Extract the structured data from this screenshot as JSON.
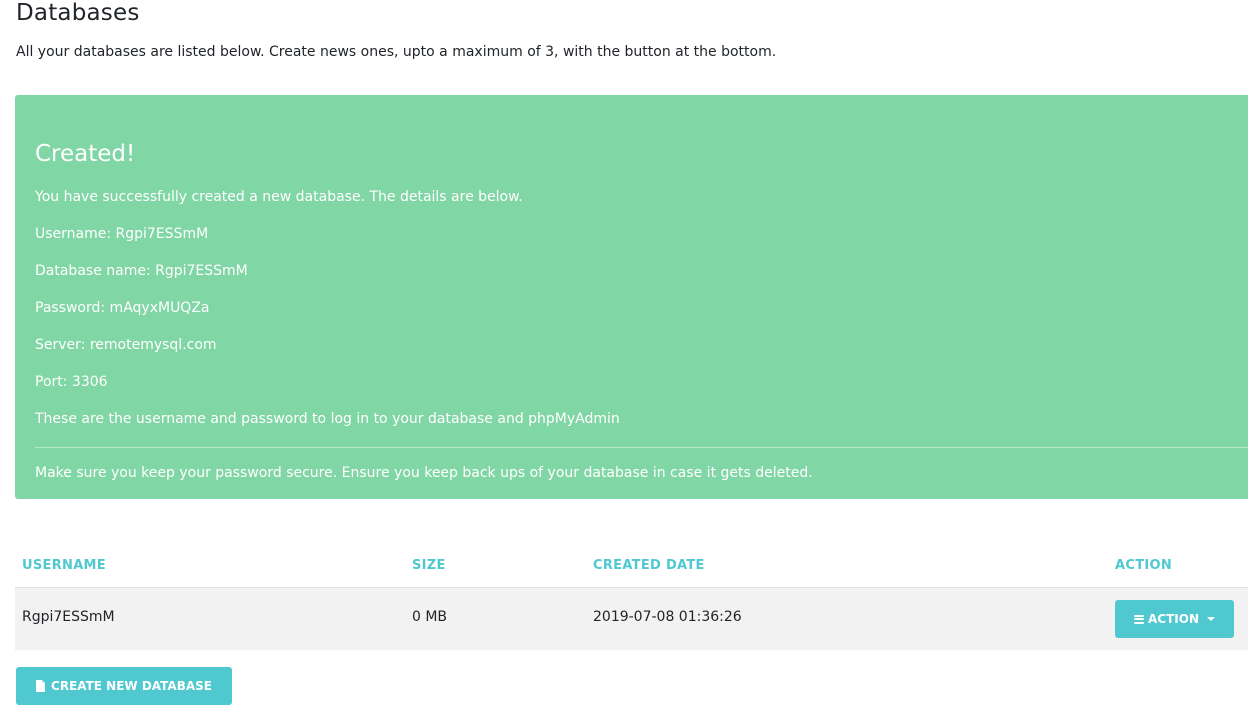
{
  "header": {
    "title": "Databases",
    "intro": "All your databases are listed below. Create news ones, upto a maximum of 3, with the button at the bottom."
  },
  "alert": {
    "heading": "Created!",
    "message": "You have successfully created a new database. The details are below.",
    "username": "Username: Rgpi7ESSmM",
    "database_name": "Database name: Rgpi7ESSmM",
    "password": "Password: mAqyxMUQZa",
    "server": "Server: remotemysql.com",
    "port": "Port: 3306",
    "login_note": "These are the username and password to log in to your database and phpMyAdmin",
    "security_note": "Make sure you keep your password secure. Ensure you keep back ups of your database in case it gets deleted.",
    "color": "#80d6a4"
  },
  "table": {
    "columns": {
      "username": "USERNAME",
      "size": "SIZE",
      "created_date": "CREATED DATE",
      "action": "ACTION"
    },
    "rows": [
      {
        "username": "Rgpi7ESSmM",
        "size": "0 MB",
        "created_date": "2019-07-08 01:36:26",
        "action_label": "ACTION"
      }
    ]
  },
  "buttons": {
    "create_label": "CREATE NEW DATABASE",
    "create_icon": "file-icon",
    "action_icon": "bars-icon"
  },
  "theme": {
    "accent": "#4fc9cf",
    "row_bg": "#f2f2f2"
  }
}
